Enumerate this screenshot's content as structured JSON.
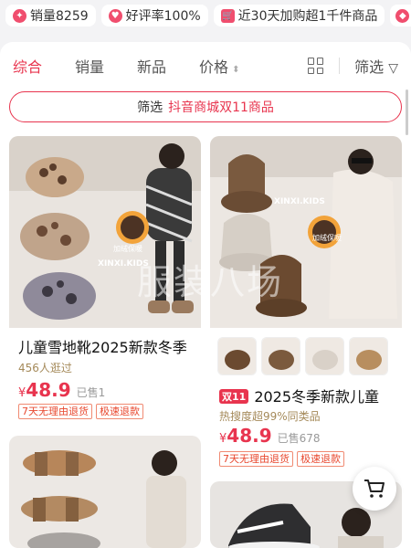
{
  "stats": [
    {
      "icon": "sales-icon",
      "label": "销量8259"
    },
    {
      "icon": "rating-icon",
      "label": "好评率100%"
    },
    {
      "icon": "cart-icon",
      "label": "近30天加购超1千件商品"
    }
  ],
  "tabs": [
    "综合",
    "销量",
    "新品",
    "价格"
  ],
  "filter_label": "筛选",
  "banner": {
    "prefix": "筛选",
    "highlight": "抖音商城双11商品"
  },
  "watermark": "服装八场",
  "products": [
    {
      "title": "儿童雪地靴2025新款冬季",
      "sub": "456人逛过",
      "yen": "¥",
      "price": "48.9",
      "sold": "已售1",
      "tags": [
        "7天无理由退货",
        "极速退款"
      ],
      "brand_text": "XINXI.KIDS",
      "heat_text": "加绒保暖"
    },
    {
      "badge": "双11",
      "title": "2025冬季新款儿童",
      "sub": "热搜度超99%同类品",
      "yen": "¥",
      "price": "48.9",
      "sold": "已售678",
      "tags": [
        "7天无理由退货",
        "极速退款"
      ],
      "brand_text": "XINXI.KIDS",
      "heat_text": "加绒保暖"
    }
  ],
  "colors": {
    "accent": "#e8344e",
    "tag": "#e8482f",
    "bg": "#f3f3f5"
  }
}
